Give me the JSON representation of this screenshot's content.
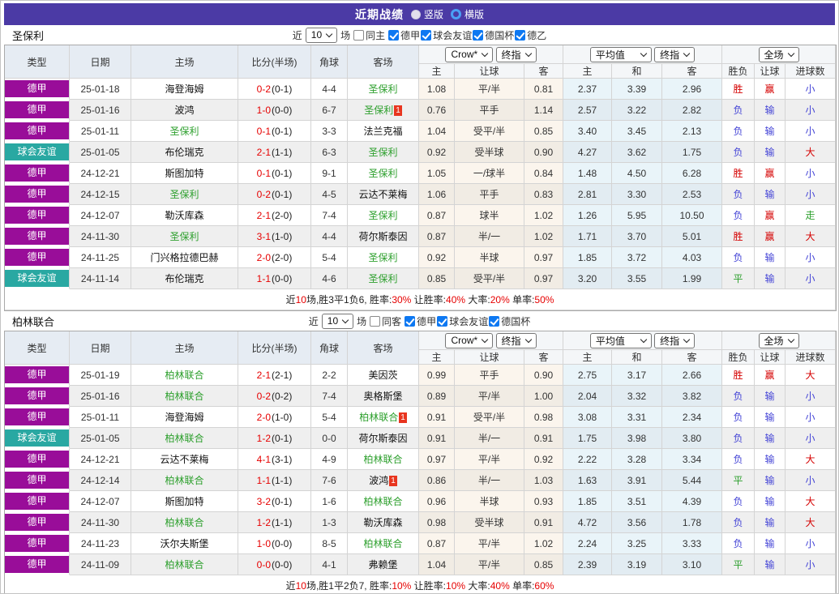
{
  "title": {
    "text": "近期战绩",
    "options": [
      {
        "label": "竖版",
        "selected": false
      },
      {
        "label": "横版",
        "selected": true
      }
    ]
  },
  "colors": {
    "title_bar": "#4b3aa5",
    "league": {
      "德甲": "#990d99",
      "球会友谊": "#29a8a2"
    },
    "self_team": "#2c9f2c",
    "score": "#e60000",
    "result": {
      "胜": "#d50000",
      "赢": "#d50000",
      "大": "#d50000",
      "负": "#4343d6",
      "输": "#4343d6",
      "小": "#4343d6",
      "平": "#2c9f2c",
      "走": "#2c9f2c"
    }
  },
  "table": {
    "headers": [
      "类型",
      "日期",
      "主场",
      "比分(半场)",
      "角球",
      "客场"
    ],
    "dropdowns": {
      "company": "Crow*",
      "company_final": "终指",
      "average": "平均值",
      "average_final": "终指",
      "scope": "全场"
    },
    "sub_headers": [
      "主",
      "让球",
      "客",
      "主",
      "和",
      "客",
      "胜负",
      "让球",
      "进球数"
    ]
  },
  "sections": [
    {
      "team": "圣保利",
      "filters": {
        "prefix": "近",
        "count": "10",
        "suffix": "场",
        "venue": {
          "label": "同主",
          "checked": false
        },
        "leagues": [
          {
            "label": "德甲",
            "checked": true
          },
          {
            "label": "球会友谊",
            "checked": true
          },
          {
            "label": "德国杯",
            "checked": true
          },
          {
            "label": "德乙",
            "checked": true
          }
        ]
      },
      "rows": [
        {
          "league": "德甲",
          "date": "25-01-18",
          "home": "海登海姆",
          "home_self": false,
          "home_red": "",
          "score_ft": "0-2",
          "score_ht": "(0-1)",
          "corners": "4-4",
          "away": "圣保利",
          "away_self": true,
          "away_red": "",
          "crow_home": "1.08",
          "crow_line": "平/半",
          "crow_away": "0.81",
          "avg_home": "2.37",
          "avg_draw": "3.39",
          "avg_away": "2.96",
          "result": "胜",
          "handicap_result": "赢",
          "goals_result": "小"
        },
        {
          "league": "德甲",
          "date": "25-01-16",
          "home": "波鸿",
          "home_self": false,
          "home_red": "",
          "score_ft": "1-0",
          "score_ht": "(0-0)",
          "corners": "6-7",
          "away": "圣保利",
          "away_self": true,
          "away_red": "1",
          "crow_home": "0.76",
          "crow_line": "平手",
          "crow_away": "1.14",
          "avg_home": "2.57",
          "avg_draw": "3.22",
          "avg_away": "2.82",
          "result": "负",
          "handicap_result": "输",
          "goals_result": "小"
        },
        {
          "league": "德甲",
          "date": "25-01-11",
          "home": "圣保利",
          "home_self": true,
          "home_red": "",
          "score_ft": "0-1",
          "score_ht": "(0-1)",
          "corners": "3-3",
          "away": "法兰克福",
          "away_self": false,
          "away_red": "",
          "crow_home": "1.04",
          "crow_line": "受平/半",
          "crow_away": "0.85",
          "avg_home": "3.40",
          "avg_draw": "3.45",
          "avg_away": "2.13",
          "result": "负",
          "handicap_result": "输",
          "goals_result": "小"
        },
        {
          "league": "球会友谊",
          "date": "25-01-05",
          "home": "布伦瑞克",
          "home_self": false,
          "home_red": "",
          "score_ft": "2-1",
          "score_ht": "(1-1)",
          "corners": "6-3",
          "away": "圣保利",
          "away_self": true,
          "away_red": "",
          "crow_home": "0.92",
          "crow_line": "受半球",
          "crow_away": "0.90",
          "avg_home": "4.27",
          "avg_draw": "3.62",
          "avg_away": "1.75",
          "result": "负",
          "handicap_result": "输",
          "goals_result": "大"
        },
        {
          "league": "德甲",
          "date": "24-12-21",
          "home": "斯图加特",
          "home_self": false,
          "home_red": "",
          "score_ft": "0-1",
          "score_ht": "(0-1)",
          "corners": "9-1",
          "away": "圣保利",
          "away_self": true,
          "away_red": "",
          "crow_home": "1.05",
          "crow_line": "一/球半",
          "crow_away": "0.84",
          "avg_home": "1.48",
          "avg_draw": "4.50",
          "avg_away": "6.28",
          "result": "胜",
          "handicap_result": "赢",
          "goals_result": "小"
        },
        {
          "league": "德甲",
          "date": "24-12-15",
          "home": "圣保利",
          "home_self": true,
          "home_red": "",
          "score_ft": "0-2",
          "score_ht": "(0-1)",
          "corners": "4-5",
          "away": "云达不莱梅",
          "away_self": false,
          "away_red": "",
          "crow_home": "1.06",
          "crow_line": "平手",
          "crow_away": "0.83",
          "avg_home": "2.81",
          "avg_draw": "3.30",
          "avg_away": "2.53",
          "result": "负",
          "handicap_result": "输",
          "goals_result": "小"
        },
        {
          "league": "德甲",
          "date": "24-12-07",
          "home": "勒沃库森",
          "home_self": false,
          "home_red": "",
          "score_ft": "2-1",
          "score_ht": "(2-0)",
          "corners": "7-4",
          "away": "圣保利",
          "away_self": true,
          "away_red": "",
          "crow_home": "0.87",
          "crow_line": "球半",
          "crow_away": "1.02",
          "avg_home": "1.26",
          "avg_draw": "5.95",
          "avg_away": "10.50",
          "result": "负",
          "handicap_result": "赢",
          "goals_result": "走"
        },
        {
          "league": "德甲",
          "date": "24-11-30",
          "home": "圣保利",
          "home_self": true,
          "home_red": "",
          "score_ft": "3-1",
          "score_ht": "(1-0)",
          "corners": "4-4",
          "away": "荷尔斯泰因",
          "away_self": false,
          "away_red": "",
          "crow_home": "0.87",
          "crow_line": "半/一",
          "crow_away": "1.02",
          "avg_home": "1.71",
          "avg_draw": "3.70",
          "avg_away": "5.01",
          "result": "胜",
          "handicap_result": "赢",
          "goals_result": "大"
        },
        {
          "league": "德甲",
          "date": "24-11-25",
          "home": "门兴格拉德巴赫",
          "home_self": false,
          "home_red": "",
          "score_ft": "2-0",
          "score_ht": "(2-0)",
          "corners": "5-4",
          "away": "圣保利",
          "away_self": true,
          "away_red": "",
          "crow_home": "0.92",
          "crow_line": "半球",
          "crow_away": "0.97",
          "avg_home": "1.85",
          "avg_draw": "3.72",
          "avg_away": "4.03",
          "result": "负",
          "handicap_result": "输",
          "goals_result": "小"
        },
        {
          "league": "球会友谊",
          "date": "24-11-14",
          "home": "布伦瑞克",
          "home_self": false,
          "home_red": "",
          "score_ft": "1-1",
          "score_ht": "(0-0)",
          "corners": "4-6",
          "away": "圣保利",
          "away_self": true,
          "away_red": "",
          "crow_home": "0.85",
          "crow_line": "受平/半",
          "crow_away": "0.97",
          "avg_home": "3.20",
          "avg_draw": "3.55",
          "avg_away": "1.99",
          "result": "平",
          "handicap_result": "输",
          "goals_result": "小"
        }
      ],
      "summary": [
        {
          "t": "近"
        },
        {
          "t": "10",
          "red": true
        },
        {
          "t": "场,胜3平1负6, 胜率:"
        },
        {
          "t": "30%",
          "red": true
        },
        {
          "t": " 让胜率:"
        },
        {
          "t": "40%",
          "red": true
        },
        {
          "t": " 大率:"
        },
        {
          "t": "20%",
          "red": true
        },
        {
          "t": " 单率:"
        },
        {
          "t": "50%",
          "red": true
        }
      ]
    },
    {
      "team": "柏林联合",
      "filters": {
        "prefix": "近",
        "count": "10",
        "suffix": "场",
        "venue": {
          "label": "同客",
          "checked": false
        },
        "leagues": [
          {
            "label": "德甲",
            "checked": true
          },
          {
            "label": "球会友谊",
            "checked": true
          },
          {
            "label": "德国杯",
            "checked": true
          }
        ]
      },
      "rows": [
        {
          "league": "德甲",
          "date": "25-01-19",
          "home": "柏林联合",
          "home_self": true,
          "home_red": "",
          "score_ft": "2-1",
          "score_ht": "(2-1)",
          "corners": "2-2",
          "away": "美因茨",
          "away_self": false,
          "away_red": "",
          "crow_home": "0.99",
          "crow_line": "平手",
          "crow_away": "0.90",
          "avg_home": "2.75",
          "avg_draw": "3.17",
          "avg_away": "2.66",
          "result": "胜",
          "handicap_result": "赢",
          "goals_result": "大"
        },
        {
          "league": "德甲",
          "date": "25-01-16",
          "home": "柏林联合",
          "home_self": true,
          "home_red": "",
          "score_ft": "0-2",
          "score_ht": "(0-2)",
          "corners": "7-4",
          "away": "奥格斯堡",
          "away_self": false,
          "away_red": "",
          "crow_home": "0.89",
          "crow_line": "平/半",
          "crow_away": "1.00",
          "avg_home": "2.04",
          "avg_draw": "3.32",
          "avg_away": "3.82",
          "result": "负",
          "handicap_result": "输",
          "goals_result": "小"
        },
        {
          "league": "德甲",
          "date": "25-01-11",
          "home": "海登海姆",
          "home_self": false,
          "home_red": "",
          "score_ft": "2-0",
          "score_ht": "(1-0)",
          "corners": "5-4",
          "away": "柏林联合",
          "away_self": true,
          "away_red": "1",
          "crow_home": "0.91",
          "crow_line": "受平/半",
          "crow_away": "0.98",
          "avg_home": "3.08",
          "avg_draw": "3.31",
          "avg_away": "2.34",
          "result": "负",
          "handicap_result": "输",
          "goals_result": "小"
        },
        {
          "league": "球会友谊",
          "date": "25-01-05",
          "home": "柏林联合",
          "home_self": true,
          "home_red": "",
          "score_ft": "1-2",
          "score_ht": "(0-1)",
          "corners": "0-0",
          "away": "荷尔斯泰因",
          "away_self": false,
          "away_red": "",
          "crow_home": "0.91",
          "crow_line": "半/一",
          "crow_away": "0.91",
          "avg_home": "1.75",
          "avg_draw": "3.98",
          "avg_away": "3.80",
          "result": "负",
          "handicap_result": "输",
          "goals_result": "小"
        },
        {
          "league": "德甲",
          "date": "24-12-21",
          "home": "云达不莱梅",
          "home_self": false,
          "home_red": "",
          "score_ft": "4-1",
          "score_ht": "(3-1)",
          "corners": "4-9",
          "away": "柏林联合",
          "away_self": true,
          "away_red": "",
          "crow_home": "0.97",
          "crow_line": "平/半",
          "crow_away": "0.92",
          "avg_home": "2.22",
          "avg_draw": "3.28",
          "avg_away": "3.34",
          "result": "负",
          "handicap_result": "输",
          "goals_result": "大"
        },
        {
          "league": "德甲",
          "date": "24-12-14",
          "home": "柏林联合",
          "home_self": true,
          "home_red": "",
          "score_ft": "1-1",
          "score_ht": "(1-1)",
          "corners": "7-6",
          "away": "波鸿",
          "away_self": false,
          "away_red": "1",
          "crow_home": "0.86",
          "crow_line": "半/一",
          "crow_away": "1.03",
          "avg_home": "1.63",
          "avg_draw": "3.91",
          "avg_away": "5.44",
          "result": "平",
          "handicap_result": "输",
          "goals_result": "小"
        },
        {
          "league": "德甲",
          "date": "24-12-07",
          "home": "斯图加特",
          "home_self": false,
          "home_red": "",
          "score_ft": "3-2",
          "score_ht": "(0-1)",
          "corners": "1-6",
          "away": "柏林联合",
          "away_self": true,
          "away_red": "",
          "crow_home": "0.96",
          "crow_line": "半球",
          "crow_away": "0.93",
          "avg_home": "1.85",
          "avg_draw": "3.51",
          "avg_away": "4.39",
          "result": "负",
          "handicap_result": "输",
          "goals_result": "大"
        },
        {
          "league": "德甲",
          "date": "24-11-30",
          "home": "柏林联合",
          "home_self": true,
          "home_red": "",
          "score_ft": "1-2",
          "score_ht": "(1-1)",
          "corners": "1-3",
          "away": "勒沃库森",
          "away_self": false,
          "away_red": "",
          "crow_home": "0.98",
          "crow_line": "受半球",
          "crow_away": "0.91",
          "avg_home": "4.72",
          "avg_draw": "3.56",
          "avg_away": "1.78",
          "result": "负",
          "handicap_result": "输",
          "goals_result": "大"
        },
        {
          "league": "德甲",
          "date": "24-11-23",
          "home": "沃尔夫斯堡",
          "home_self": false,
          "home_red": "",
          "score_ft": "1-0",
          "score_ht": "(0-0)",
          "corners": "8-5",
          "away": "柏林联合",
          "away_self": true,
          "away_red": "",
          "crow_home": "0.87",
          "crow_line": "平/半",
          "crow_away": "1.02",
          "avg_home": "2.24",
          "avg_draw": "3.25",
          "avg_away": "3.33",
          "result": "负",
          "handicap_result": "输",
          "goals_result": "小"
        },
        {
          "league": "德甲",
          "date": "24-11-09",
          "home": "柏林联合",
          "home_self": true,
          "home_red": "",
          "score_ft": "0-0",
          "score_ht": "(0-0)",
          "corners": "4-1",
          "away": "弗赖堡",
          "away_self": false,
          "away_red": "",
          "crow_home": "1.04",
          "crow_line": "平/半",
          "crow_away": "0.85",
          "avg_home": "2.39",
          "avg_draw": "3.19",
          "avg_away": "3.10",
          "result": "平",
          "handicap_result": "输",
          "goals_result": "小"
        }
      ],
      "summary": [
        {
          "t": "近"
        },
        {
          "t": "10",
          "red": true
        },
        {
          "t": "场,胜1平2负7, 胜率:"
        },
        {
          "t": "10%",
          "red": true
        },
        {
          "t": " 让胜率:"
        },
        {
          "t": "10%",
          "red": true
        },
        {
          "t": " 大率:"
        },
        {
          "t": "40%",
          "red": true
        },
        {
          "t": " 单率:"
        },
        {
          "t": "60%",
          "red": true
        }
      ]
    }
  ]
}
